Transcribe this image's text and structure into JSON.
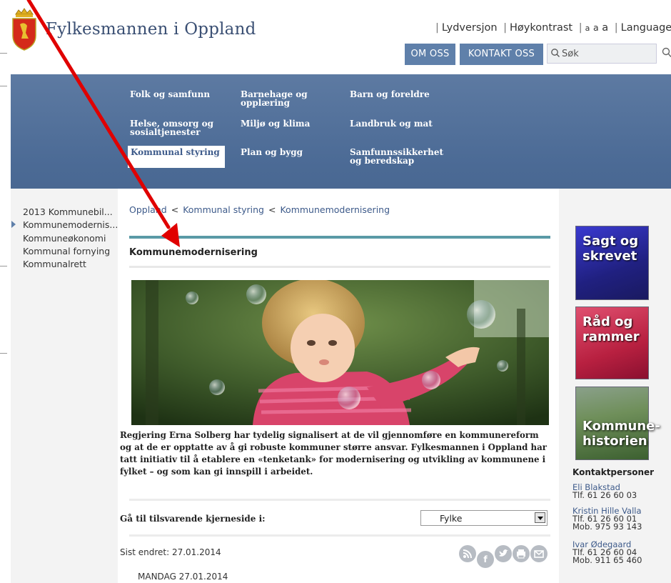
{
  "header": {
    "site_title": "Fylkesmannen i Oppland",
    "util": {
      "audio": "Lydversjon",
      "contrast": "Høykontrast",
      "text_size": [
        "a",
        "a",
        "a"
      ],
      "language": "Language"
    },
    "buttons": {
      "om_oss": "OM OSS",
      "kontakt_oss": "KONTAKT OSS"
    },
    "search": {
      "placeholder": "Søk"
    }
  },
  "nav": {
    "columns": [
      [
        "Folk og samfunn",
        "Helse, omsorg og sosialtjenester",
        "Kommunal styring"
      ],
      [
        "Barnehage og opplæring",
        "Miljø og klima",
        "Plan og bygg"
      ],
      [
        "Barn og foreldre",
        "Landbruk og mat",
        "Samfunnssikkerhet og beredskap"
      ]
    ],
    "active": "Kommunal styring"
  },
  "left_sidebar": {
    "items": [
      "2013 Kommunebil...",
      "Kommunemodernis...",
      "Kommuneøkonomi",
      "Kommunal fornying",
      "Kommunalrett"
    ],
    "active_index": 1
  },
  "breadcrumb": [
    "Oppland",
    "Kommunal styring",
    "Kommunemodernisering"
  ],
  "breadcrumb_sep": "<",
  "main": {
    "title": "Kommunemodernisering",
    "lead": "Regjering Erna Solberg har tydelig signalisert at de vil gjennomføre en kommunereform og at de er opptatte av å gi robuste kommuner større ansvar.  Fylkesmannen i Oppland har tatt initiativ til å etablere en «tenketank» for modernisering og utvikling av kommunene i fylket – og som kan gi innspill i arbeidet.",
    "goto_label": "Gå til tilsvarende kjerneside i:",
    "select_value": "Fylke",
    "last_changed": "Sist endret: 27.01.2014",
    "date_line": "MANDAG 27.01.2014"
  },
  "right_sidebar": {
    "promos": [
      "Sagt og skrevet",
      "Råd og rammer",
      "Kommune-historien"
    ],
    "contacts_heading": "Kontaktpersoner",
    "contacts": [
      {
        "name": "Eli Blakstad",
        "lines": [
          "Tlf. 61 26 60 03"
        ]
      },
      {
        "name": "Kristin Hille Valla",
        "lines": [
          "Tlf. 61 26 60 01",
          "Mob. 975 93 143"
        ]
      },
      {
        "name": "Ivar Ødegaard",
        "lines": [
          "Tlf. 61 26 60 04",
          "Mob. 911 65 460"
        ]
      }
    ]
  },
  "colors": {
    "accent": "#5f80aa",
    "nav": "#4b6a95",
    "teal": "#5a9aa6",
    "annotation": "#e00000"
  }
}
